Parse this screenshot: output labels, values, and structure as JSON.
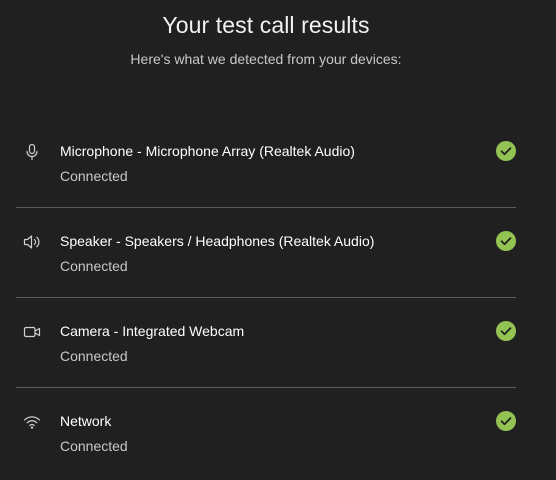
{
  "header": {
    "title": "Your test call results",
    "subtitle": "Here's what we detected from your devices:"
  },
  "devices": [
    {
      "icon": "microphone-icon",
      "name": "Microphone - Microphone Array (Realtek Audio)",
      "status": "Connected"
    },
    {
      "icon": "speaker-icon",
      "name": "Speaker - Speakers / Headphones (Realtek Audio)",
      "status": "Connected"
    },
    {
      "icon": "camera-icon",
      "name": "Camera - Integrated Webcam",
      "status": "Connected"
    },
    {
      "icon": "wifi-icon",
      "name": "Network",
      "status": "Connected"
    }
  ],
  "colors": {
    "background": "#202020",
    "success": "#92c353",
    "divider": "#5a5a5a"
  }
}
